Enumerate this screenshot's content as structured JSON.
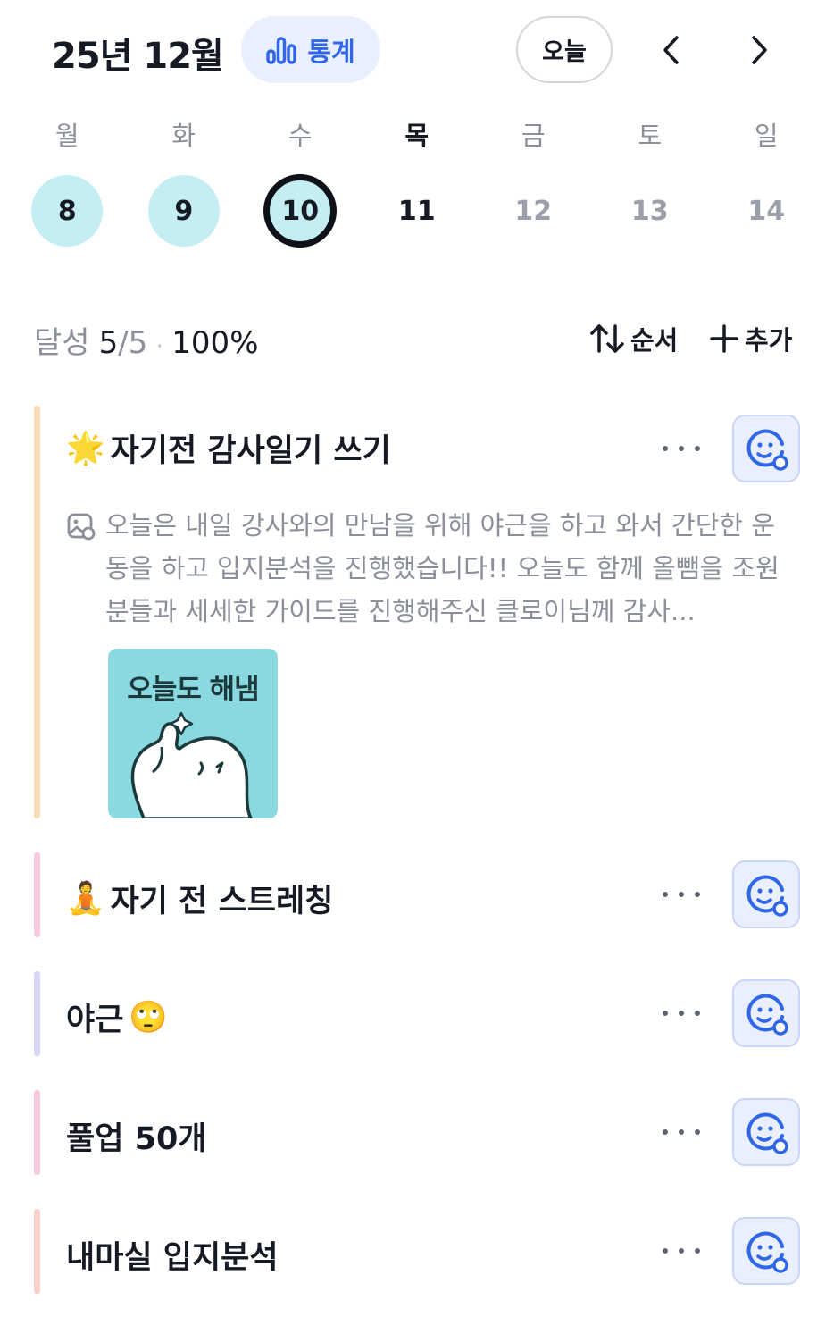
{
  "header": {
    "month_title": "25년 12월",
    "stats_label": "통계",
    "today_label": "오늘",
    "prev_icon": "chevron-left-icon",
    "next_icon": "chevron-right-icon"
  },
  "week": {
    "days": [
      {
        "dow": "월",
        "date": "8",
        "state": "done"
      },
      {
        "dow": "화",
        "date": "9",
        "state": "done"
      },
      {
        "dow": "수",
        "date": "10",
        "state": "selected"
      },
      {
        "dow": "목",
        "date": "11",
        "state": "today"
      },
      {
        "dow": "금",
        "date": "12",
        "state": "future"
      },
      {
        "dow": "토",
        "date": "13",
        "state": "future"
      },
      {
        "dow": "일",
        "date": "14",
        "state": "future"
      }
    ]
  },
  "summary": {
    "label": "달성",
    "done": "5",
    "total": "/5",
    "separator": "·",
    "percent": "100%",
    "sort_label": "순서",
    "add_label": "추가"
  },
  "habits": [
    {
      "emoji": "🌟",
      "title": "자기전 감사일기 쓰기",
      "color": "#fbdcb8",
      "memo": "오늘은 내일 강사와의 만남을 위해 야근을 하고 와서 간단한 운동을 하고 입지분석을 진행했습니다!! 오늘도 함께 올뺌을 조원분들과 세세한 가이드를 진행해주신 클로이님께 감사...",
      "sticker_text": "오늘도 해냄"
    },
    {
      "emoji": "🧘",
      "title": "자기 전 스트레칭",
      "color": "#f9c9e0"
    },
    {
      "emoji": "🙄",
      "title": "야근",
      "color": "#d8d6f8"
    },
    {
      "emoji": "",
      "title": "풀업 50개",
      "color": "#f9c9e0"
    },
    {
      "emoji": "",
      "title": "내마실 입지분석",
      "color": "#fbd0cc"
    }
  ],
  "colors": {
    "accent_blue": "#2f67e8",
    "done_circle": "#c5eef3",
    "check_bg": "#e9effd"
  }
}
